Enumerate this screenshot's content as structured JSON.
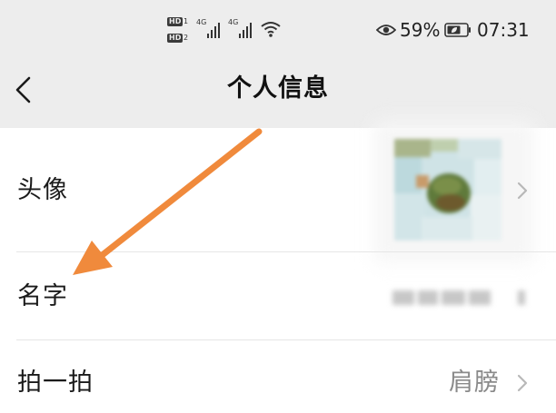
{
  "status_bar": {
    "hd_badges": [
      "HD",
      "HD"
    ],
    "sim_labels": [
      "1",
      "2"
    ],
    "signal_labels": [
      "4G",
      "4G"
    ],
    "battery_percent": "59%",
    "time": "07:31",
    "icons": [
      "hd-icon",
      "signal-icon",
      "wifi-icon",
      "eye-icon",
      "battery-icon"
    ]
  },
  "header": {
    "title": "个人信息",
    "back_icon": "chevron-left-icon"
  },
  "rows": [
    {
      "label": "头像",
      "value": "",
      "icon": "chevron-right-icon"
    },
    {
      "label": "名字",
      "value": "",
      "icon": "chevron-right-icon"
    },
    {
      "label": "拍一拍",
      "value": "肩膀",
      "icon": "chevron-right-icon"
    }
  ],
  "annotation": {
    "color": "#f08a3c",
    "icon": "arrow-icon"
  },
  "colors": {
    "header_bg": "#ededed",
    "list_bg": "#ffffff",
    "divider": "#e6e6e6",
    "secondary_text": "#8a8a8a",
    "chevron": "#b8b8b8"
  }
}
